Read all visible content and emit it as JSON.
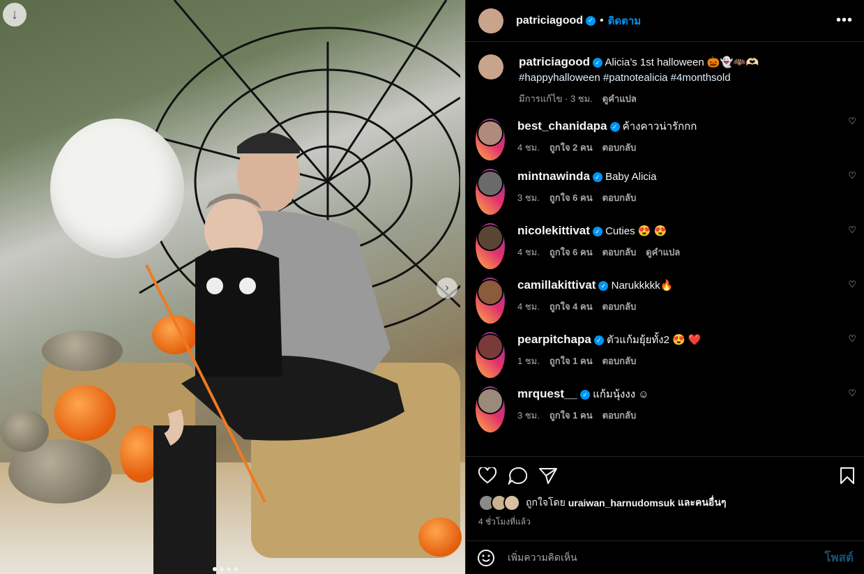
{
  "post": {
    "author": "patriciagood",
    "follow_label": "ติดตาม",
    "more_label": "•••",
    "caption_line1": "Alicia’s 1st halloween 🎃👻🦇🫶🏻",
    "caption_tags": "#happyhalloween #patnotealicia #4monthsold",
    "edited_label": "มีการแก้ไข · 3 ชม.",
    "translate_label": "ดูคำแปล"
  },
  "comments": [
    {
      "user": "best_chanidapa",
      "text": "ค้างคาวน่ารักกก",
      "time": "4 ชม.",
      "likes": "ถูกใจ 2 คน",
      "reply": "ตอบกลับ",
      "extra": "",
      "color": "#b08a7a"
    },
    {
      "user": "mintnawinda",
      "text": "Baby Alicia",
      "time": "3 ชม.",
      "likes": "ถูกใจ 6 คน",
      "reply": "ตอบกลับ",
      "extra": "",
      "color": "#6a6a6a"
    },
    {
      "user": "nicolekittivat",
      "text": "Cuties 😍 😍",
      "time": "4 ชม.",
      "likes": "ถูกใจ 6 คน",
      "reply": "ตอบกลับ",
      "extra": "ดูคำแปล",
      "color": "#5a4434"
    },
    {
      "user": "camillakittivat",
      "text": "Narukkkkk🔥",
      "time": "4 ชม.",
      "likes": "ถูกใจ 4 คน",
      "reply": "ตอบกลับ",
      "extra": "",
      "color": "#8a5c3c"
    },
    {
      "user": "pearpitchapa",
      "text": "ตัวแก้มยุ้ยทั้ง2 😍 ❤️",
      "time": "1 ชม.",
      "likes": "ถูกใจ 1 คน",
      "reply": "ตอบกลับ",
      "extra": "",
      "color": "#7a3a3a"
    },
    {
      "user": "mrquest__",
      "text": "แก้มนุ้งงง ☺",
      "time": "3 ชม.",
      "likes": "ถูกใจ 1 คน",
      "reply": "ตอบกลับ",
      "extra": "",
      "color": "#9a8a7a"
    }
  ],
  "footer": {
    "liked_by_prefix": "ถูกใจโดย",
    "liked_by_user": "uraiwan_harnudomsuk",
    "liked_by_suffix": "และคนอื่นๆ",
    "time_ago": "4 ชั่วโมงที่แล้ว",
    "add_comment_placeholder": "เพิ่มความคิดเห็น",
    "post_label": "โพสต์"
  },
  "icons": {
    "down": "arrow-down-icon",
    "next": "chevron-right-icon",
    "like": "heart-icon",
    "comment": "comment-icon",
    "share": "send-icon",
    "save": "bookmark-icon",
    "emoji": "emoji-icon",
    "verified": "verified-badge-icon"
  },
  "colors": {
    "accent": "#0095f6",
    "background": "#000000",
    "muted": "#a8a8a8"
  }
}
